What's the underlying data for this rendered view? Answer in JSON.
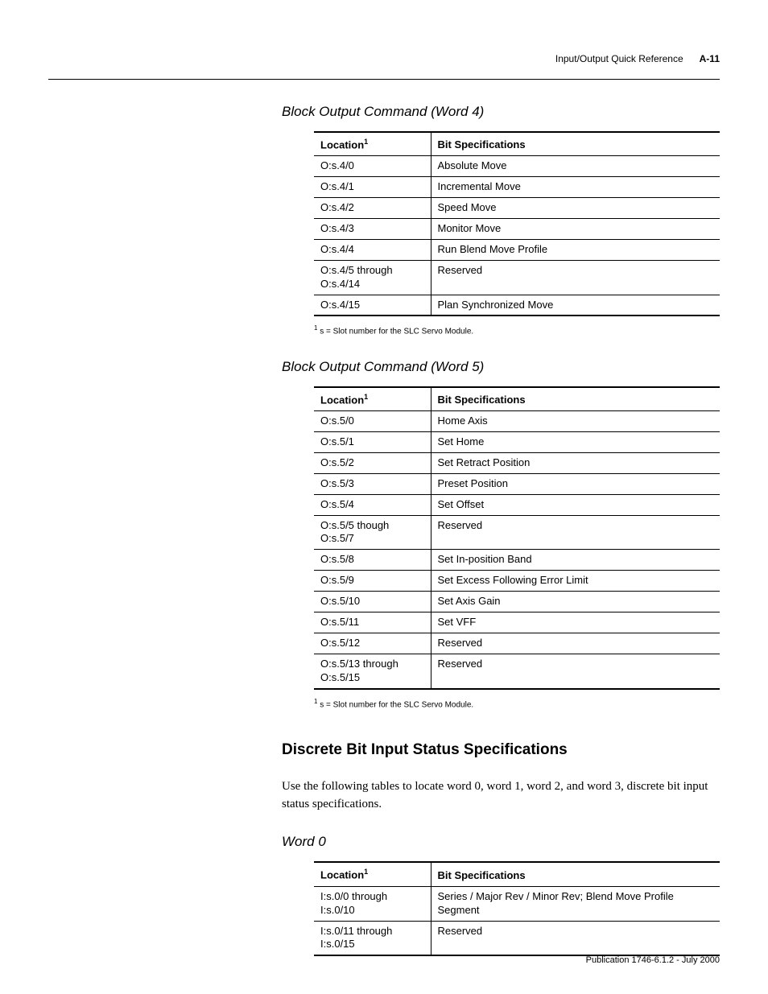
{
  "header": {
    "breadcrumb": "Input/Output Quick Reference",
    "pageno": "A-11"
  },
  "sections": {
    "s1": {
      "title": "Block Output Command (Word 4)",
      "col_loc": "Location",
      "col_loc_sup": "1",
      "col_bit": "Bit Specifications",
      "footnote_sup": "1",
      "footnote": " s = Slot number for the SLC Servo Module.",
      "rows": [
        {
          "loc": "O:s.4/0",
          "bit": "Absolute Move"
        },
        {
          "loc": "O:s.4/1",
          "bit": "Incremental Move"
        },
        {
          "loc": "O:s.4/2",
          "bit": "Speed Move"
        },
        {
          "loc": "O:s.4/3",
          "bit": "Monitor Move"
        },
        {
          "loc": "O:s.4/4",
          "bit": "Run Blend Move Profile"
        },
        {
          "loc": "O:s.4/5 through O:s.4/14",
          "bit": "Reserved"
        },
        {
          "loc": "O:s.4/15",
          "bit": "Plan Synchronized Move"
        }
      ]
    },
    "s2": {
      "title": "Block Output Command (Word 5)",
      "col_loc": "Location",
      "col_loc_sup": "1",
      "col_bit": "Bit Specifications",
      "footnote_sup": "1",
      "footnote": " s = Slot number for the SLC Servo Module.",
      "rows": [
        {
          "loc": "O:s.5/0",
          "bit": "Home Axis"
        },
        {
          "loc": "O:s.5/1",
          "bit": "Set Home"
        },
        {
          "loc": "O:s.5/2",
          "bit": "Set Retract Position"
        },
        {
          "loc": "O:s.5/3",
          "bit": "Preset Position"
        },
        {
          "loc": "O:s.5/4",
          "bit": "Set Offset"
        },
        {
          "loc": "O:s.5/5 though O:s.5/7",
          "bit": "Reserved"
        },
        {
          "loc": "O:s.5/8",
          "bit": "Set In-position Band"
        },
        {
          "loc": "O:s.5/9",
          "bit": "Set Excess Following Error Limit"
        },
        {
          "loc": "O:s.5/10",
          "bit": "Set Axis Gain"
        },
        {
          "loc": "O:s.5/11",
          "bit": "Set VFF"
        },
        {
          "loc": "O:s.5/12",
          "bit": "Reserved"
        },
        {
          "loc": "O:s.5/13 through O:s.5/15",
          "bit": "Reserved"
        }
      ]
    },
    "s3": {
      "heading": "Discrete Bit Input Status Specifications",
      "para": "Use the following tables to locate word 0, word 1, word 2, and word 3, discrete bit input status specifications.",
      "title": "Word 0",
      "col_loc": "Location",
      "col_loc_sup": "1",
      "col_bit": "Bit Specifications",
      "rows": [
        {
          "loc": "I:s.0/0 through I:s.0/10",
          "bit": "Series / Major Rev / Minor Rev; Blend Move Profile Segment"
        },
        {
          "loc": "I:s.0/11 through I:s.0/15",
          "bit": "Reserved"
        }
      ]
    }
  },
  "footer": {
    "pub": "Publication 1746-6.1.2 - July 2000"
  }
}
